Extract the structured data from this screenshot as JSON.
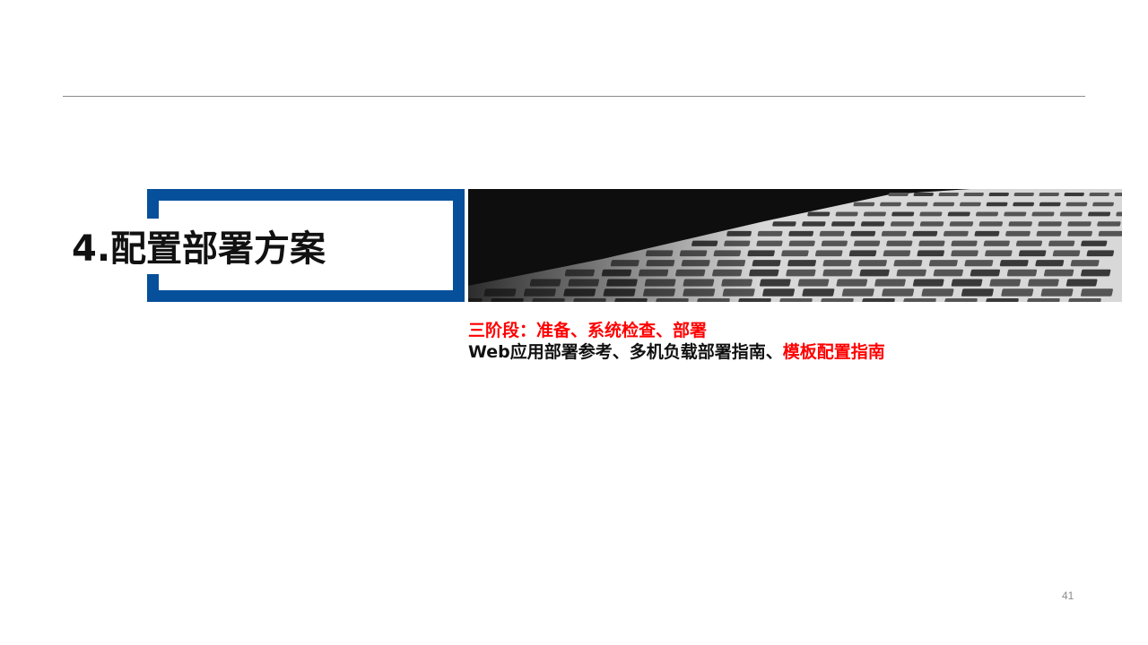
{
  "slide": {
    "title": "4.配置部署方案",
    "phases_line": "三阶段：准备、系统检查、部署",
    "guides_prefix": "Web应用部署参考、多机负载部署指南、",
    "guides_highlight": "模板配置指南",
    "page_number": "41"
  },
  "colors": {
    "frame_blue": "#064f9a",
    "highlight_red": "#ff0000",
    "rule_gray": "#8c8c8c",
    "text_dark": "#111111"
  },
  "image": {
    "description_icon": "building-facade-image"
  }
}
